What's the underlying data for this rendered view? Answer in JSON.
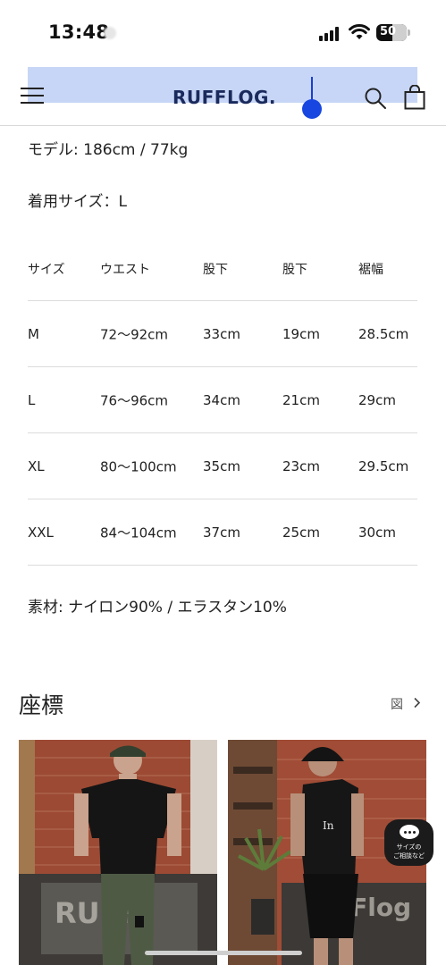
{
  "status": {
    "time": "13:48",
    "battery": "50"
  },
  "header": {
    "logo": "RUFFLOG."
  },
  "specs": {
    "model": "モデル: 186cm / 77kg",
    "size_worn": "着用サイズ：L",
    "material": "素材: ナイロン90% / エラスタン10%"
  },
  "size_table": {
    "headers": [
      "サイズ",
      "ウエスト",
      "股下",
      "股下",
      "裾幅"
    ],
    "rows": [
      [
        "M",
        "72〜92cm",
        "33cm",
        "19cm",
        "28.5cm"
      ],
      [
        "L",
        "76〜96cm",
        "34cm",
        "21cm",
        "29cm"
      ],
      [
        "XL",
        "80〜100cm",
        "35cm",
        "23cm",
        "29.5cm"
      ],
      [
        "XXL",
        "84〜104cm",
        "37cm",
        "25cm",
        "30cm"
      ]
    ]
  },
  "section": {
    "title": "座標",
    "link": "図"
  },
  "chat": {
    "line1": "サイズの",
    "line2": "ご相談など"
  },
  "icons": [
    "menu-icon",
    "search-icon",
    "bag-icon",
    "chevron-right-icon",
    "chat-icon"
  ]
}
